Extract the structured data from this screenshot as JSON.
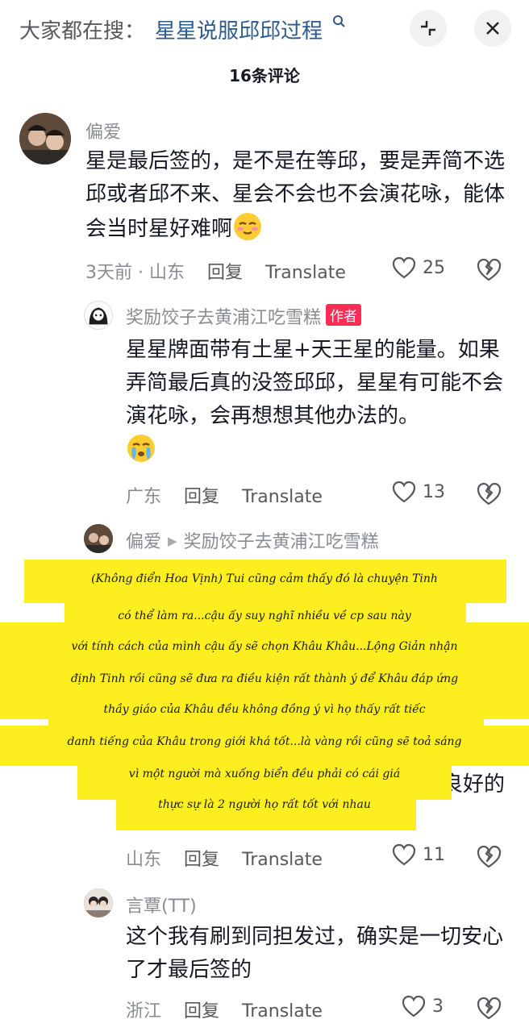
{
  "header": {
    "search_prefix": "大家都在搜：",
    "search_query": "星星说服邱邱过程",
    "collapse_icon": "collapse-icon",
    "close_icon": "close-icon"
  },
  "comment_count": "16条评论",
  "comments": [
    {
      "username": "偏爱",
      "text": "星是最后签的，是不是在等邱，要是弄简不选邱或者邱不来、星会不会也不会演花咏，能体会当时星好难啊",
      "emoji": "relieved-face-emoji",
      "time_location": "3天前 · 山东",
      "reply_label": "回复",
      "translate_label": "Translate",
      "likes": "25"
    },
    {
      "username": "奖励饺子去黄浦江吃雪糕",
      "badge": "作者",
      "text": "星星牌面带有土星+天王星的能量。如果弄简最后真的没签邱邱，星星有可能不会演花咏，会再想想其他办法的。",
      "emoji": "crying-face-emoji",
      "time_location": "广东",
      "reply_label": "回复",
      "translate_label": "Translate",
      "likes": "13"
    },
    {
      "username": "偏爱",
      "reply_to": "奖励饺子去黄浦江吃雪糕",
      "partial_text": "良好的",
      "time_location": "山东",
      "reply_label": "回复",
      "translate_label": "Translate",
      "likes": "11"
    },
    {
      "username": "言覃(TT)",
      "text": "这个我有刷到同担发过，确实是一切安心了才最后签的",
      "time_location": "浙江",
      "reply_label": "回复",
      "translate_label": "Translate",
      "likes": "3"
    }
  ],
  "overlay": {
    "lines": [
      "(Không điển Hoa Vịnh) Tui cũng cảm thấy đó là chuyện Tinh",
      "có thể làm ra...cậu ấy suy nghĩ nhiều về cp sau này",
      "với tính cách của mình cậu ấy sẽ chọn Khâu Khâu...Lộng Giản nhận",
      "định Tinh rồi cũng sẽ đưa ra điều kiện rất thành ý để Khâu đáp ứng",
      "thầy giáo của Khâu đều không đồng ý vì họ thấy rất tiếc",
      "danh tiếng của Khâu trong giới khá tốt...là vàng rồi cũng sẽ toả sáng",
      "vì một người mà xuống biển đều phải có cái giá",
      "thực sự là 2 người họ rất tốt với nhau"
    ],
    "color": "#fcee1f"
  },
  "colors": {
    "link": "#2d5a8c",
    "badge": "#fe2c55",
    "secondary_text": "#8a8b91"
  }
}
